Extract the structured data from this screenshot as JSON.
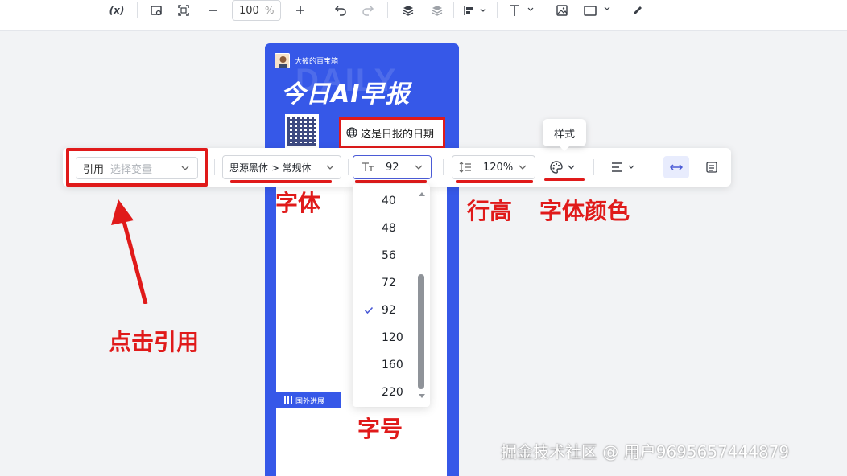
{
  "toolbar": {
    "variable_label": "(x)",
    "zoom_value": "100",
    "zoom_unit": "%"
  },
  "poster": {
    "author": "大彼的百宝箱",
    "title": "今日AI早报",
    "deco_text": "DAILY",
    "date_text": "这是日报的日期",
    "section_label": "国外进展"
  },
  "float_toolbar": {
    "ref_label": "引用",
    "ref_placeholder": "选择变量",
    "font_family": "思源黑体 > 常规体",
    "font_size": "92",
    "line_height": "120%",
    "style_tooltip": "样式"
  },
  "font_size_options": [
    "40",
    "48",
    "56",
    "72",
    "92",
    "120",
    "160",
    "220"
  ],
  "font_size_selected": "92",
  "annotations": {
    "click_ref": "点击引用",
    "font": "字体",
    "font_size": "字号",
    "line_height": "行高",
    "font_color": "字体颜色"
  },
  "watermark": "掘金技术社区 @ 用户9695657444879",
  "colors": {
    "annotation_red": "#e01a1a",
    "poster_blue": "#3658e8",
    "accent": "#4b5bd6"
  }
}
